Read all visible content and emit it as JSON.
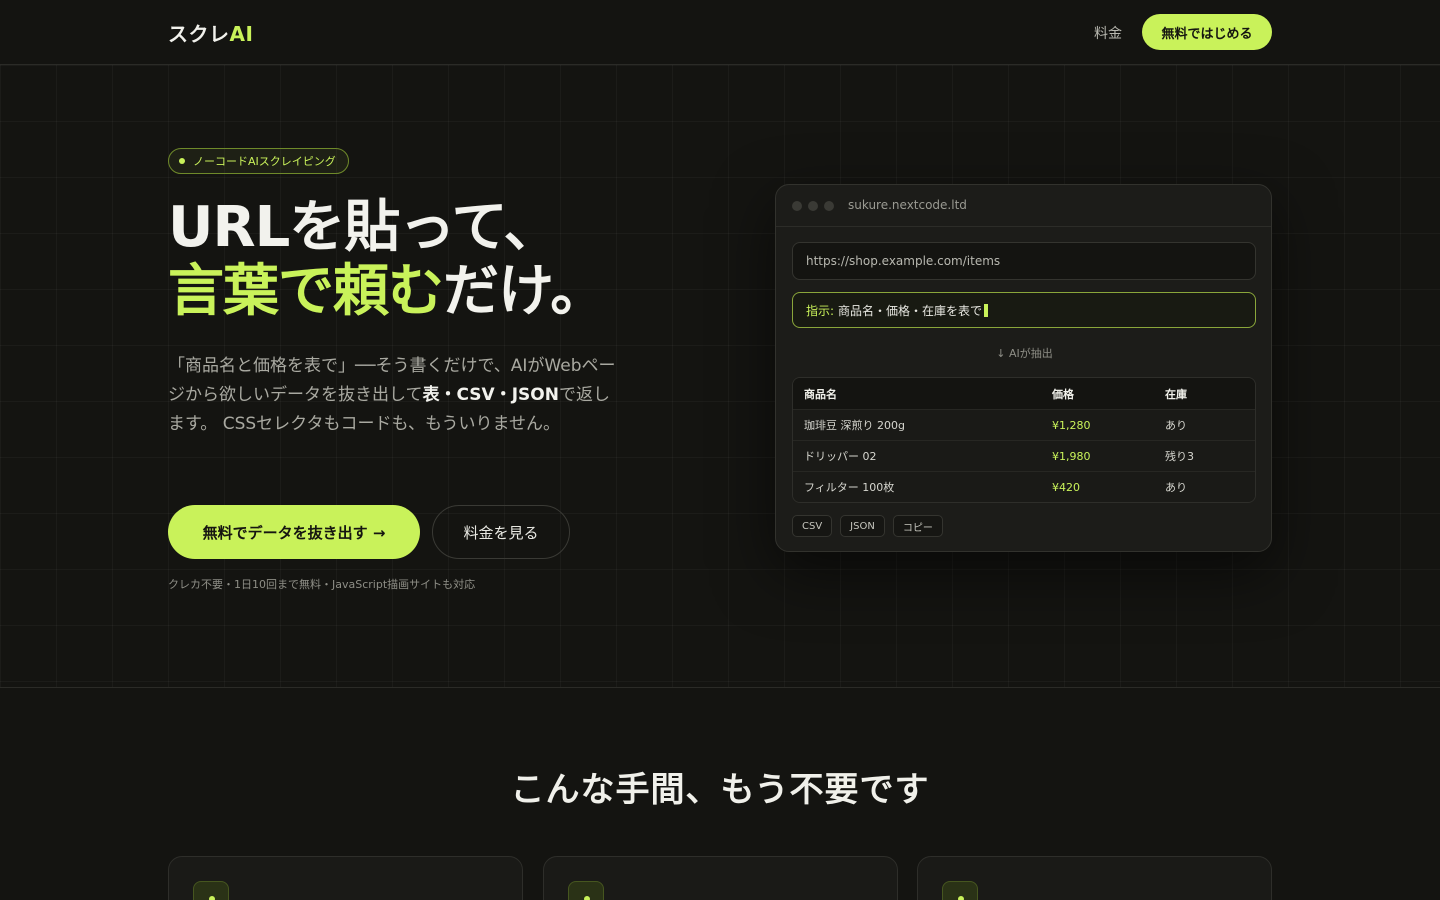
{
  "header": {
    "logo_main": "スクレ",
    "logo_accent": "AI",
    "nav_pricing": "料金",
    "cta": "無料ではじめる"
  },
  "hero": {
    "badge": "ノーコードAIスクレイピング",
    "title_line1": "URLを貼って、",
    "title_line2_accent": "言葉で頼む",
    "title_line2_rest": "だけ。",
    "desc_part1": "「商品名と価格を表で」──そう書くだけで、AIがWebページから欲しいデータを抜き出して",
    "desc_bold1": "表・CSV・JSON",
    "desc_part2": "で返します。 CSSセレクタもコードも、もういりません。",
    "primary_button": "無料でデータを抜き出す →",
    "secondary_button": "料金を見る",
    "note": "クレカ不要・1日10回まで無料・JavaScript描画サイトも対応"
  },
  "mock": {
    "domain": "sukure.nextcode.ltd",
    "url_value": "https://shop.example.com/items",
    "prompt_label": "指示:",
    "prompt_value": "商品名・価格・在庫を表で",
    "arrow_label": "↓ AIが抽出",
    "table": {
      "headers": [
        "商品名",
        "価格",
        "在庫"
      ],
      "rows": [
        [
          "珈琲豆 深煎り 200g",
          "¥1,280",
          "あり"
        ],
        [
          "ドリッパー 02",
          "¥1,980",
          "残り3"
        ],
        [
          "フィルター 100枚",
          "¥420",
          "あり"
        ]
      ]
    },
    "exports": [
      "CSV",
      "JSON",
      "コピー"
    ]
  },
  "section": {
    "title": "こんな手間、もう不要です"
  },
  "colors": {
    "background": "#141411",
    "accent": "#c9f25a",
    "text": "#e8e8e2"
  },
  "icons": {
    "window_dots": "window-control-dots",
    "badge_dot": "status-dot-icon"
  }
}
